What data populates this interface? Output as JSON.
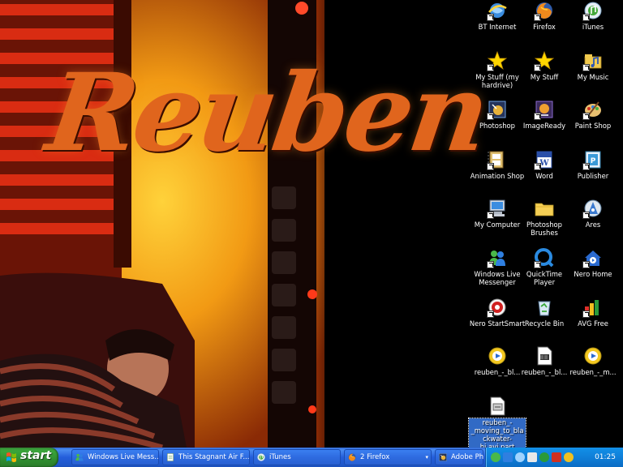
{
  "wallpaper": {
    "title": "Reuben",
    "accent": "#e0651d"
  },
  "desktop_icons": [
    {
      "label": "BT Internet",
      "icon": "bt-internet-icon"
    },
    {
      "label": "Firefox",
      "icon": "firefox-icon"
    },
    {
      "label": "iTunes",
      "icon": "itunes-icon"
    },
    {
      "label": "My Stuff (my hardrive)",
      "icon": "star-folder-icon"
    },
    {
      "label": "My Stuff",
      "icon": "star-folder-icon"
    },
    {
      "label": "My Music",
      "icon": "my-music-icon"
    },
    {
      "label": "Photoshop",
      "icon": "photoshop-icon"
    },
    {
      "label": "ImageReady",
      "icon": "imageready-icon"
    },
    {
      "label": "Paint Shop",
      "icon": "paint-shop-icon"
    },
    {
      "label": "Animation Shop",
      "icon": "animation-shop-icon"
    },
    {
      "label": "Word",
      "icon": "word-icon"
    },
    {
      "label": "Publisher",
      "icon": "publisher-icon"
    },
    {
      "label": "My Computer",
      "icon": "my-computer-icon"
    },
    {
      "label": "Photoshop Brushes",
      "icon": "folder-icon"
    },
    {
      "label": "Ares",
      "icon": "ares-icon"
    },
    {
      "label": "Windows Live Messenger",
      "icon": "messenger-icon"
    },
    {
      "label": "QuickTime Player",
      "icon": "quicktime-icon"
    },
    {
      "label": "Nero Home",
      "icon": "nero-home-icon"
    },
    {
      "label": "Nero StartSmart",
      "icon": "nero-startsmart-icon"
    },
    {
      "label": "Recycle Bin",
      "icon": "recycle-bin-icon"
    },
    {
      "label": "AVG Free",
      "icon": "avg-icon"
    },
    {
      "label": "reuben_-_bl...",
      "icon": "media-file-icon"
    },
    {
      "label": "reuben_-_bl...",
      "icon": "video-file-icon"
    },
    {
      "label": "reuben_-_m...",
      "icon": "media-file-icon"
    },
    {
      "label": "reuben_-_moving_to_blackwater-hi.avi.part",
      "icon": "partial-file-icon"
    }
  ],
  "taskbar": {
    "start_label": "start",
    "tasks": [
      {
        "label": "Windows Live Mess...",
        "icon": "messenger-icon"
      },
      {
        "label": "This Stagnant Air F...",
        "icon": "notepad-icon"
      },
      {
        "label": "iTunes",
        "icon": "itunes-icon"
      },
      {
        "label": "2 Firefox",
        "icon": "firefox-icon",
        "dropdown": "▾"
      },
      {
        "label": "Adobe Photoshop",
        "icon": "photoshop-icon"
      }
    ],
    "tray_icons": [
      "network-icon",
      "messenger-tray-icon",
      "itunes-tray-icon",
      "volume-icon",
      "avg-tray-icon",
      "ares-tray-icon",
      "font-tray-icon"
    ],
    "clock": "01:25"
  }
}
